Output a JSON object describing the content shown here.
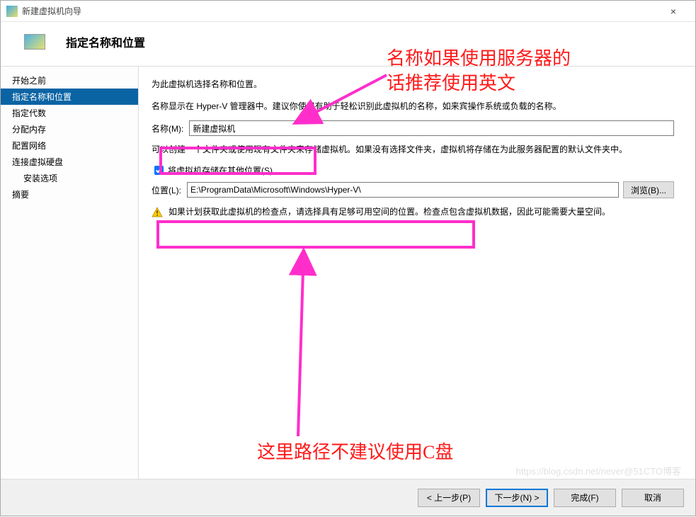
{
  "titlebar": {
    "title": "新建虚拟机向导",
    "close": "×"
  },
  "header": {
    "title": "指定名称和位置"
  },
  "sidebar": {
    "items": [
      {
        "label": "开始之前"
      },
      {
        "label": "指定名称和位置",
        "selected": true
      },
      {
        "label": "指定代数"
      },
      {
        "label": "分配内存"
      },
      {
        "label": "配置网络"
      },
      {
        "label": "连接虚拟硬盘"
      },
      {
        "label": "安装选项",
        "sub": true
      },
      {
        "label": "摘要"
      }
    ]
  },
  "content": {
    "intro": "为此虚拟机选择名称和位置。",
    "desc1": "名称显示在 Hyper-V 管理器中。建议你使用有助于轻松识别此虚拟机的名称，如来宾操作系统或负载的名称。",
    "nameLabel": "名称(M):",
    "nameValue": "新建虚拟机",
    "desc2": "可以创建一个文件夹或使用现有文件夹来存储虚拟机。如果没有选择文件夹，虚拟机将存储在为此服务器配置的默认文件夹中。",
    "storeCheckbox": "将虚拟机存储在其他位置(S)",
    "locationLabel": "位置(L):",
    "locationValue": "E:\\ProgramData\\Microsoft\\Windows\\Hyper-V\\",
    "browse": "浏览(B)...",
    "warn": "如果计划获取此虚拟机的检查点，请选择具有足够可用空间的位置。检查点包含虚拟机数据，因此可能需要大量空间。"
  },
  "footer": {
    "prev": "< 上一步(P)",
    "next": "下一步(N) >",
    "finish": "完成(F)",
    "cancel": "取消"
  },
  "annotations": {
    "top": "名称如果使用服务器的\n话推荐使用英文",
    "bottom": "这里路径不建议使用C盘"
  },
  "watermark": "https://blog.csdn.net/never@51CTO博客"
}
